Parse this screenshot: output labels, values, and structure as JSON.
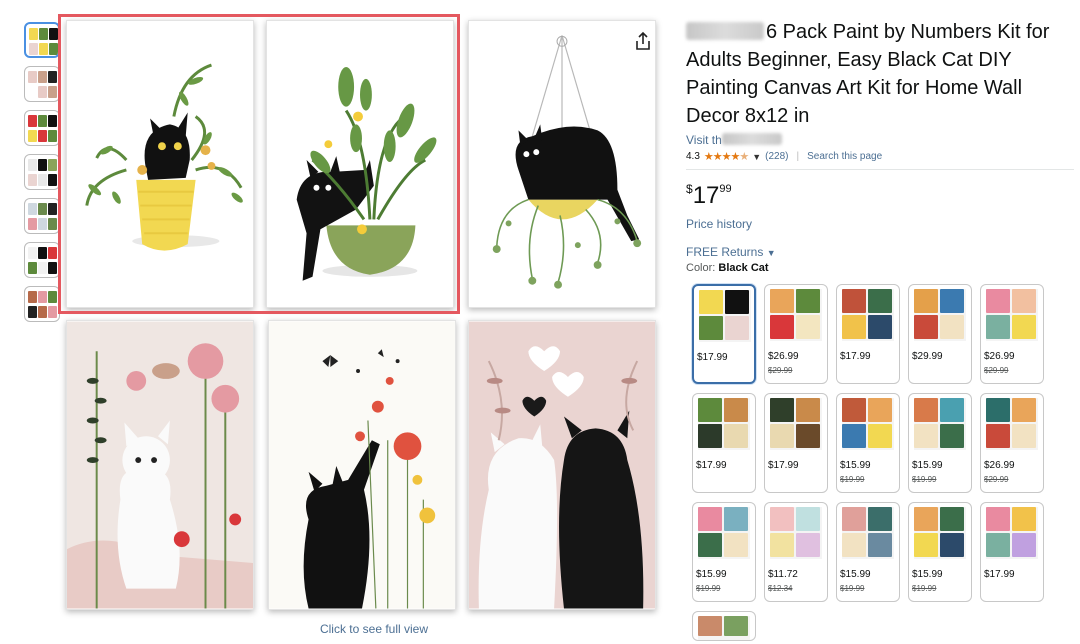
{
  "product": {
    "title_suffix": "6 Pack Paint by Numbers Kit for Adults Beginner, Easy Black Cat DIY Painting Canvas Art Kit for Home Wall Decor 8x12 in",
    "visit_prefix": "Visit th",
    "rating": "4.3",
    "rating_count": "(228)",
    "search_page": "Search this page",
    "price_symbol": "$",
    "price_whole": "17",
    "price_fraction": "99",
    "price_history": "Price history",
    "free_returns": "FREE Returns",
    "color_label": "Color:",
    "color_value": "Black Cat"
  },
  "gallery": {
    "click_full_view": "Click to see full view",
    "share_icon": "share-icon",
    "thumb_count": 7
  },
  "swatches": [
    {
      "price": "$17.99",
      "old": "",
      "selected": true,
      "theme": "cats"
    },
    {
      "price": "$26.99",
      "old": "$29.99",
      "theme": "cats2"
    },
    {
      "price": "$17.99",
      "old": "",
      "theme": "windows"
    },
    {
      "price": "$29.99",
      "old": "",
      "theme": "city"
    },
    {
      "price": "$26.99",
      "old": "$29.99",
      "theme": "pink"
    },
    {
      "price": "$17.99",
      "old": "",
      "theme": "catsgreen"
    },
    {
      "price": "$17.99",
      "old": "",
      "theme": "catsdark"
    },
    {
      "price": "$15.99",
      "old": "$19.99",
      "theme": "canyon"
    },
    {
      "price": "$15.99",
      "old": "$19.99",
      "theme": "arch"
    },
    {
      "price": "$26.99",
      "old": "$29.99",
      "theme": "mountain"
    },
    {
      "price": "$15.99",
      "old": "$19.99",
      "theme": "floral"
    },
    {
      "price": "$11.72",
      "old": "$12.34",
      "theme": "pastel"
    },
    {
      "price": "$15.99",
      "old": "$19.99",
      "theme": "landscape"
    },
    {
      "price": "$15.99",
      "old": "$19.99",
      "theme": "sunset"
    },
    {
      "price": "$17.99",
      "old": "",
      "theme": "cocktail"
    },
    {
      "price": "",
      "old": "",
      "theme": "hills"
    }
  ],
  "colors": {
    "accent_link": "#4c6f93",
    "selection_border": "#e4585f",
    "star": "#e47911"
  }
}
